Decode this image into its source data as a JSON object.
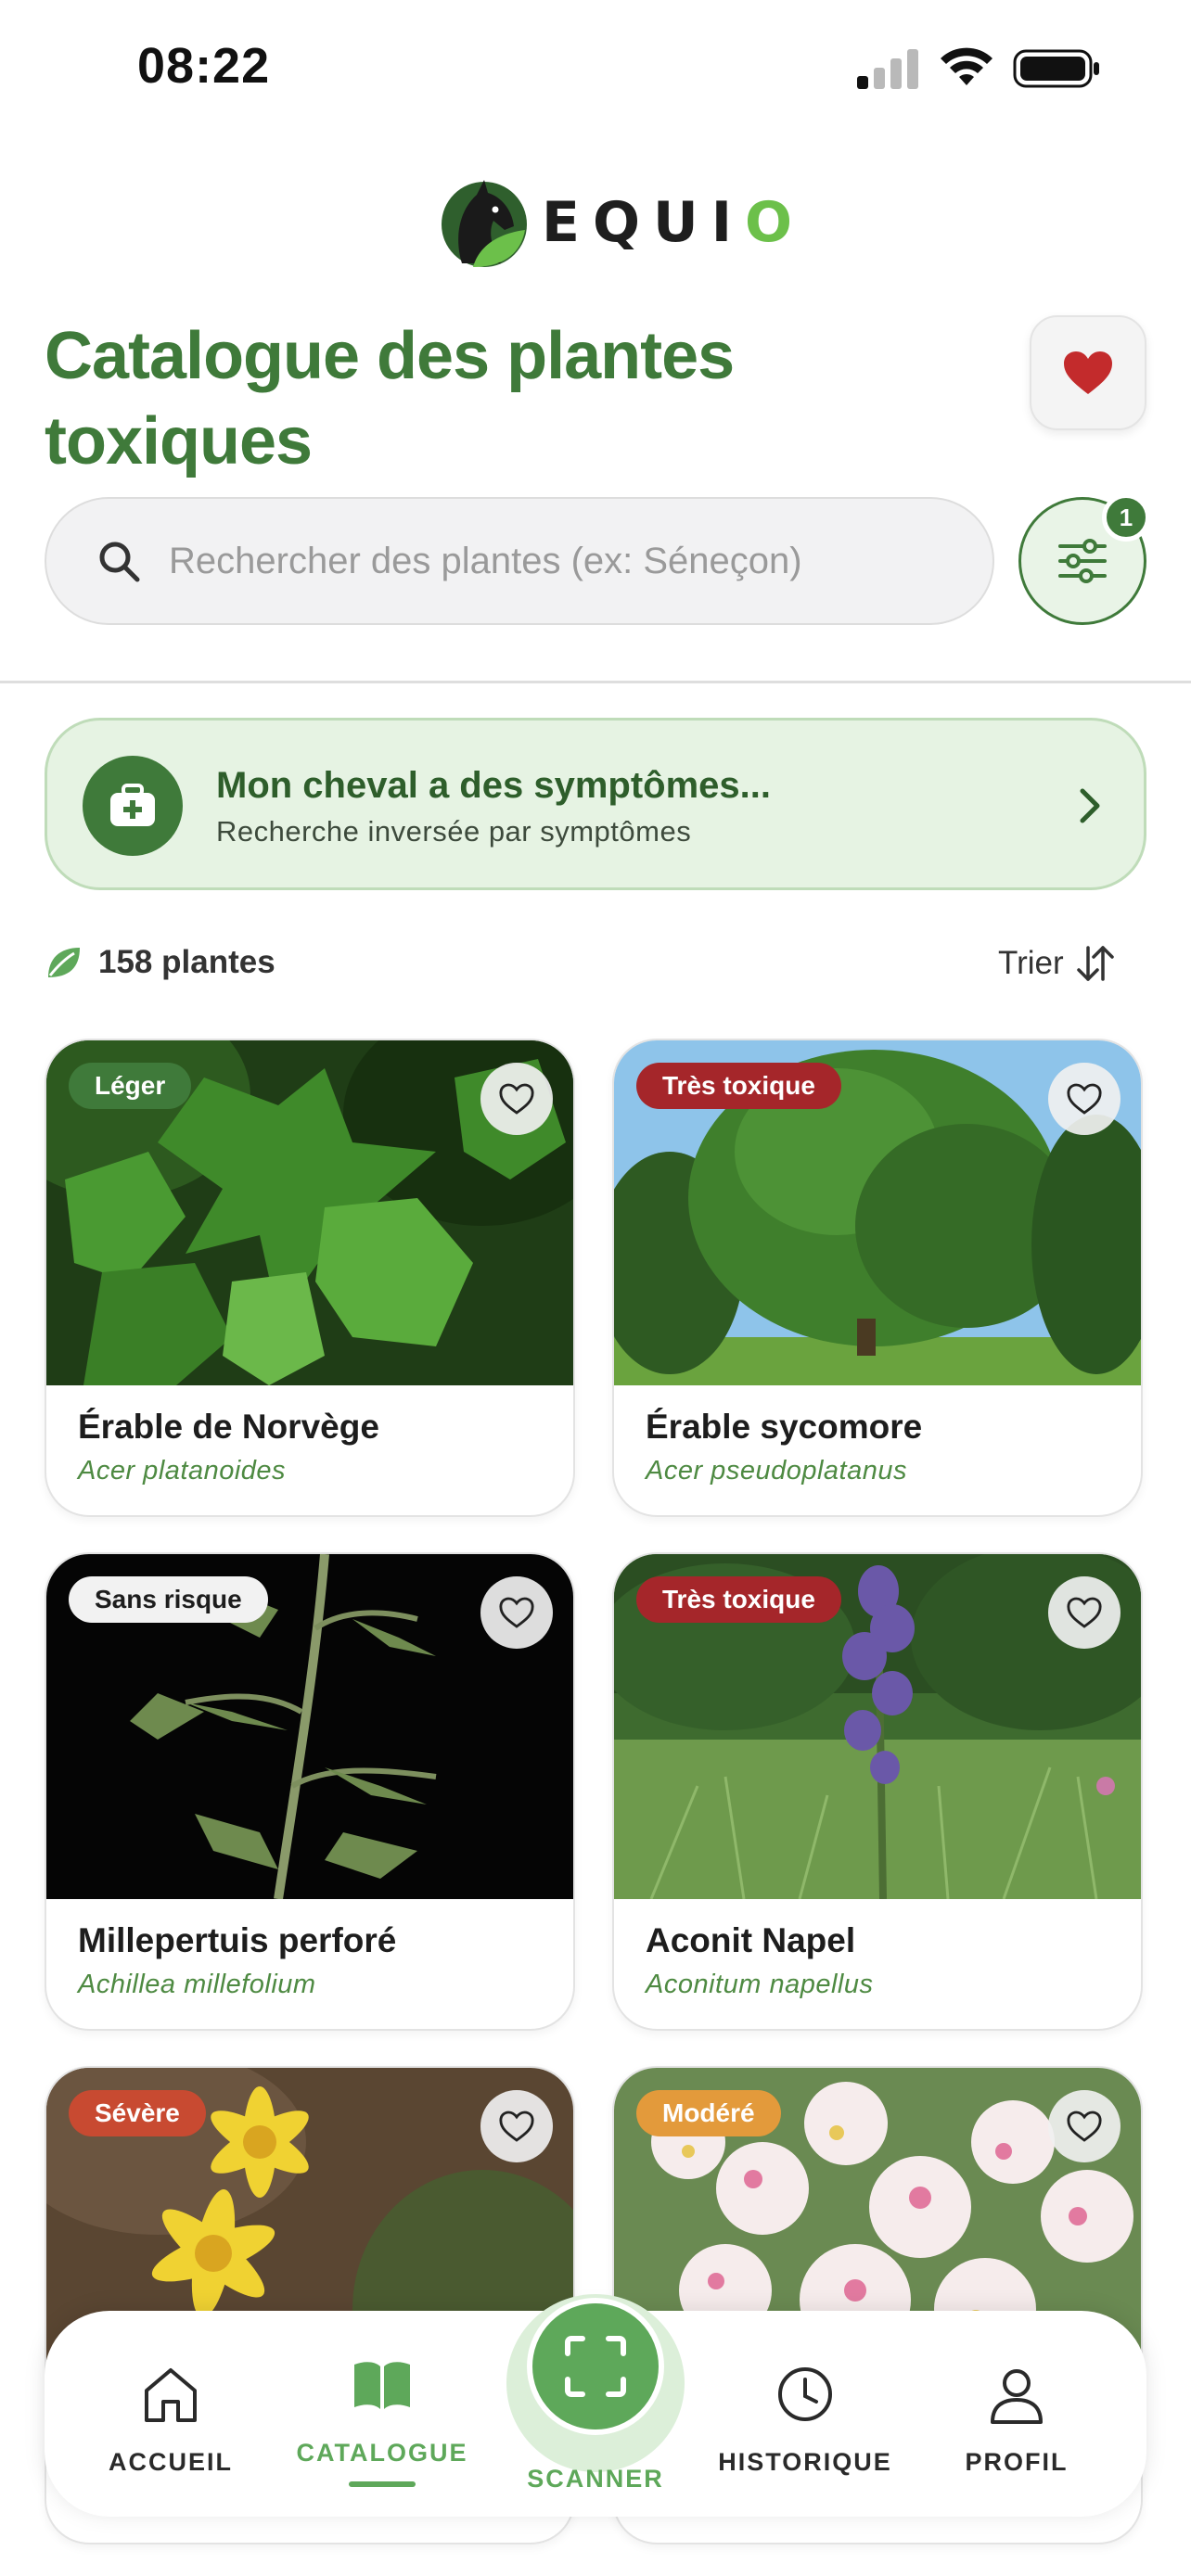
{
  "status_bar": {
    "time": "08:22"
  },
  "brand": {
    "name_prefix": "EQUI",
    "name_suffix": "O"
  },
  "header": {
    "title": "Catalogue des plantes toxiques"
  },
  "search": {
    "placeholder": "Rechercher des plantes (ex: Séneçon)",
    "value": ""
  },
  "filter": {
    "active_count": "1"
  },
  "symptom_banner": {
    "title": "Mon cheval a des symptômes...",
    "subtitle": "Recherche inversée par symptômes"
  },
  "results": {
    "count_label": "158 plantes",
    "sort_label": "Trier"
  },
  "toxicity_colors": {
    "Léger": "#3f7a3a",
    "Très toxique": "#a5262a",
    "Sans risque": "#f2f2f2",
    "Sévère": "#c84a31",
    "Modéré": "#e39a3b"
  },
  "plants": [
    {
      "badge": "Léger",
      "name": "Érable de Norvège",
      "latin": "Acer platanoides"
    },
    {
      "badge": "Très toxique",
      "name": "Érable sycomore",
      "latin": "Acer pseudoplatanus"
    },
    {
      "badge": "Sans risque",
      "name": "Millepertuis perforé",
      "latin": "Achillea millefolium"
    },
    {
      "badge": "Très toxique",
      "name": "Aconit Napel",
      "latin": "Aconitum napellus"
    },
    {
      "badge": "Sévère",
      "name": "",
      "latin": ""
    },
    {
      "badge": "Modéré",
      "name": "",
      "latin": ""
    }
  ],
  "nav": {
    "home": "ACCUEIL",
    "catalogue": "CATALOGUE",
    "scanner": "SCANNER",
    "history": "HISTORIQUE",
    "profile": "PROFIL",
    "active": "catalogue"
  }
}
